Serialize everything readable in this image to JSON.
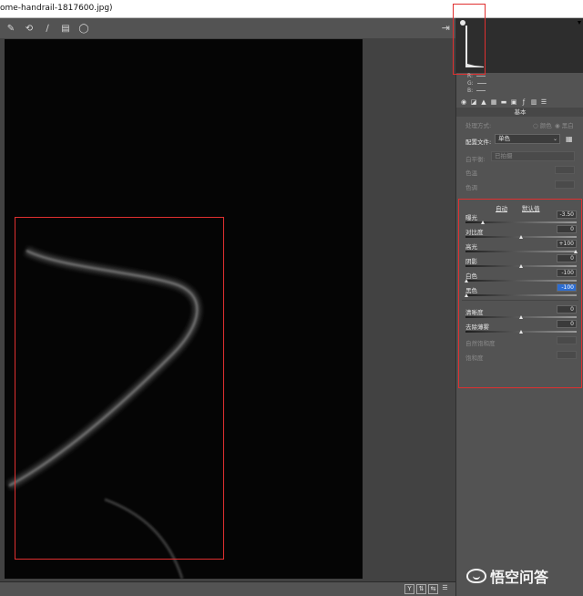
{
  "window": {
    "title": "ome-handrail-1817600.jpg)"
  },
  "toolbar": {
    "tool_icons": [
      "white-balance-icon",
      "straighten-icon",
      "brush-icon",
      "preferences-icon",
      "rotate-icon"
    ],
    "tool_glyphs": [
      "✎",
      "⟲",
      "∕",
      "▤",
      "◯"
    ],
    "exit_glyph": "⇥"
  },
  "histogram": {
    "r": "R:",
    "g": "G:",
    "b": "B:"
  },
  "panel": {
    "section_title": "基本",
    "treatment_label": "处理方式:",
    "color_option": "颜色",
    "bw_option": "黑白",
    "profile_label": "配置文件:",
    "profile_value": "单色",
    "wb_label": "白平衡:",
    "wb_value": "已拍摄",
    "temp_label": "色温",
    "tint_label": "色调",
    "auto_label": "自动",
    "default_label": "默认值"
  },
  "adjustments": [
    {
      "label": "曝光",
      "value": "-3.50",
      "level": 0.15
    },
    {
      "label": "对比度",
      "value": "0",
      "level": 0.5
    },
    {
      "label": "高光",
      "value": "+100",
      "level": 1.0
    },
    {
      "label": "阴影",
      "value": "0",
      "level": 0.5
    },
    {
      "label": "白色",
      "value": "-100",
      "level": 0.0
    },
    {
      "label": "黑色",
      "value": "-100",
      "level": 0.0
    },
    {
      "label": "清晰度",
      "value": "0",
      "level": 0.5
    },
    {
      "label": "去除薄雾",
      "value": "0",
      "level": 0.5
    },
    {
      "label": "自然饱和度",
      "value": "",
      "level": 0.5
    },
    {
      "label": "饱和度",
      "value": "",
      "level": 0.5
    }
  ],
  "statusbar": {
    "buttons": [
      "Y",
      "⇅",
      "⇆",
      "☰"
    ]
  },
  "watermark": {
    "text": "悟空问答"
  }
}
